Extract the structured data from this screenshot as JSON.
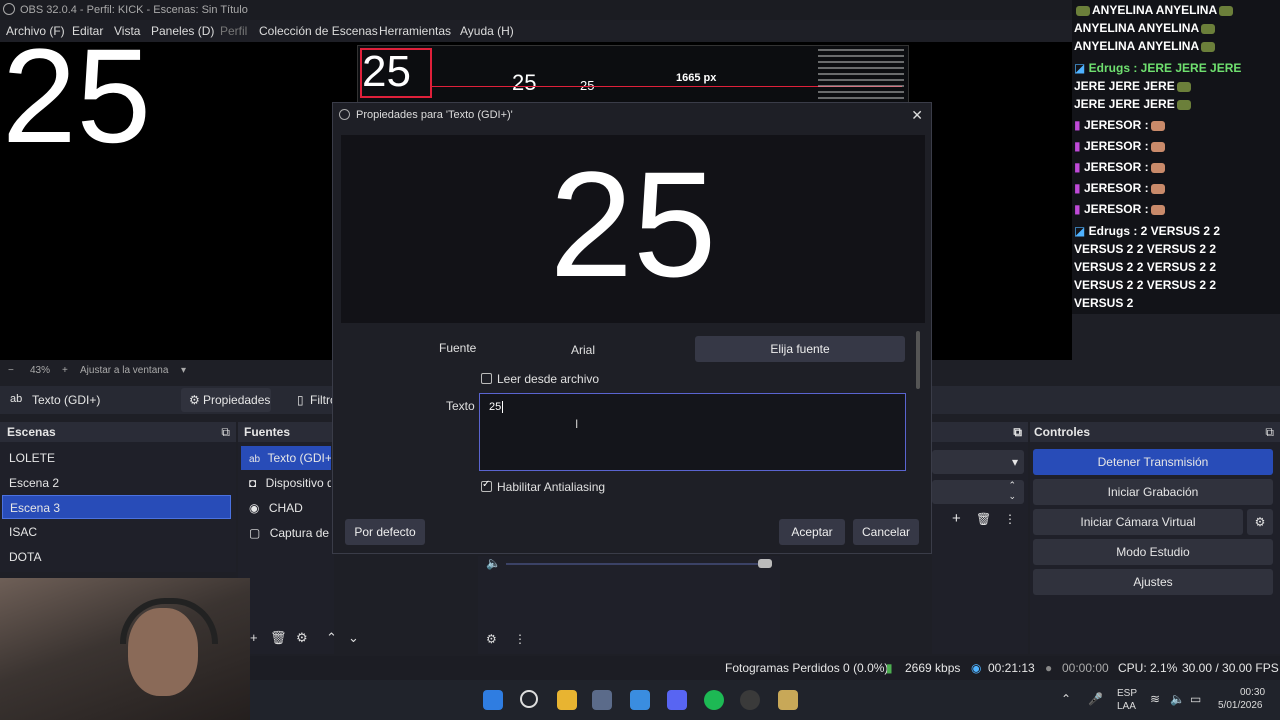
{
  "window": {
    "title": "OBS 32.0.4 - Perfil: KICK - Escenas: Sin Título"
  },
  "menu": {
    "items": [
      "Archivo (F)",
      "Editar",
      "Vista",
      "Paneles (D)",
      "Perfil",
      "Colección de Escenas",
      "Herramientas",
      "Ayuda (H)"
    ]
  },
  "preview": {
    "big_text": "25",
    "mini_size_label": "1665 px"
  },
  "zoom": {
    "minus": "−",
    "level": "43%",
    "plus": "+",
    "fit_label": "Ajustar a la ventana"
  },
  "source_bar": {
    "selected_source": "Texto (GDI+)",
    "properties_label": "Propiedades",
    "filters_label": "Filtro"
  },
  "scenes": {
    "header": "Escenas",
    "items": [
      "LOLETE",
      "Escena 2",
      "Escena 3",
      "ISAC",
      "DOTA"
    ],
    "selected_index": 2
  },
  "sources": {
    "header": "Fuentes",
    "items": [
      "Texto (GDI+)",
      "Dispositivo de",
      "CHAD",
      "Captura de pa"
    ]
  },
  "controls": {
    "header": "Controles",
    "buttons": [
      "Detener Transmisión",
      "Iniciar Grabación",
      "Iniciar Cámara Virtual",
      "Modo Estudio",
      "Ajustes"
    ]
  },
  "dialog": {
    "title": "Propiedades para 'Texto (GDI+)'",
    "preview_text": "25",
    "font_label": "Fuente",
    "font_value": "Arial",
    "choose_font_label": "Elija fuente",
    "read_from_file_label": "Leer desde archivo",
    "read_from_file_checked": false,
    "text_label": "Texto",
    "text_value": "25",
    "antialiasing_label": "Habilitar Antialiasing",
    "antialiasing_checked": true,
    "defaults_label": "Por defecto",
    "accept_label": "Aceptar",
    "cancel_label": "Cancelar"
  },
  "status": {
    "dropped_frames": "Fotogramas Perdidos 0 (0.0%)",
    "bitrate": "2669 kbps",
    "stream_time": "00:21:13",
    "record_time": "00:00:00",
    "cpu": "CPU: 2.1%",
    "fps": "30.00 / 30.00 FPS"
  },
  "chat": {
    "lines": [
      "ANYELINA ANYELINA",
      "ANYELINA ANYELINA",
      "ANYELINA ANYELINA",
      "Edrugs : JERE JERE JERE",
      "JERE JERE JERE",
      "JERE JERE JERE",
      "JERESOR :",
      "JERESOR :",
      "JERESOR :",
      "JERESOR :",
      "JERESOR :",
      "Edrugs : 2 VERSUS 2 2",
      "VERSUS 2 2 VERSUS 2 2",
      "VERSUS 2 2 VERSUS 2 2",
      "VERSUS 2 2 VERSUS 2 2",
      "VERSUS 2"
    ]
  },
  "tray": {
    "language": "ESP",
    "layout": "LAA",
    "time": "00:30",
    "date": "5/01/2026"
  },
  "colors": {
    "accent": "#284cb8",
    "selection_red": "#e0203a",
    "background": "#1e1f26"
  }
}
